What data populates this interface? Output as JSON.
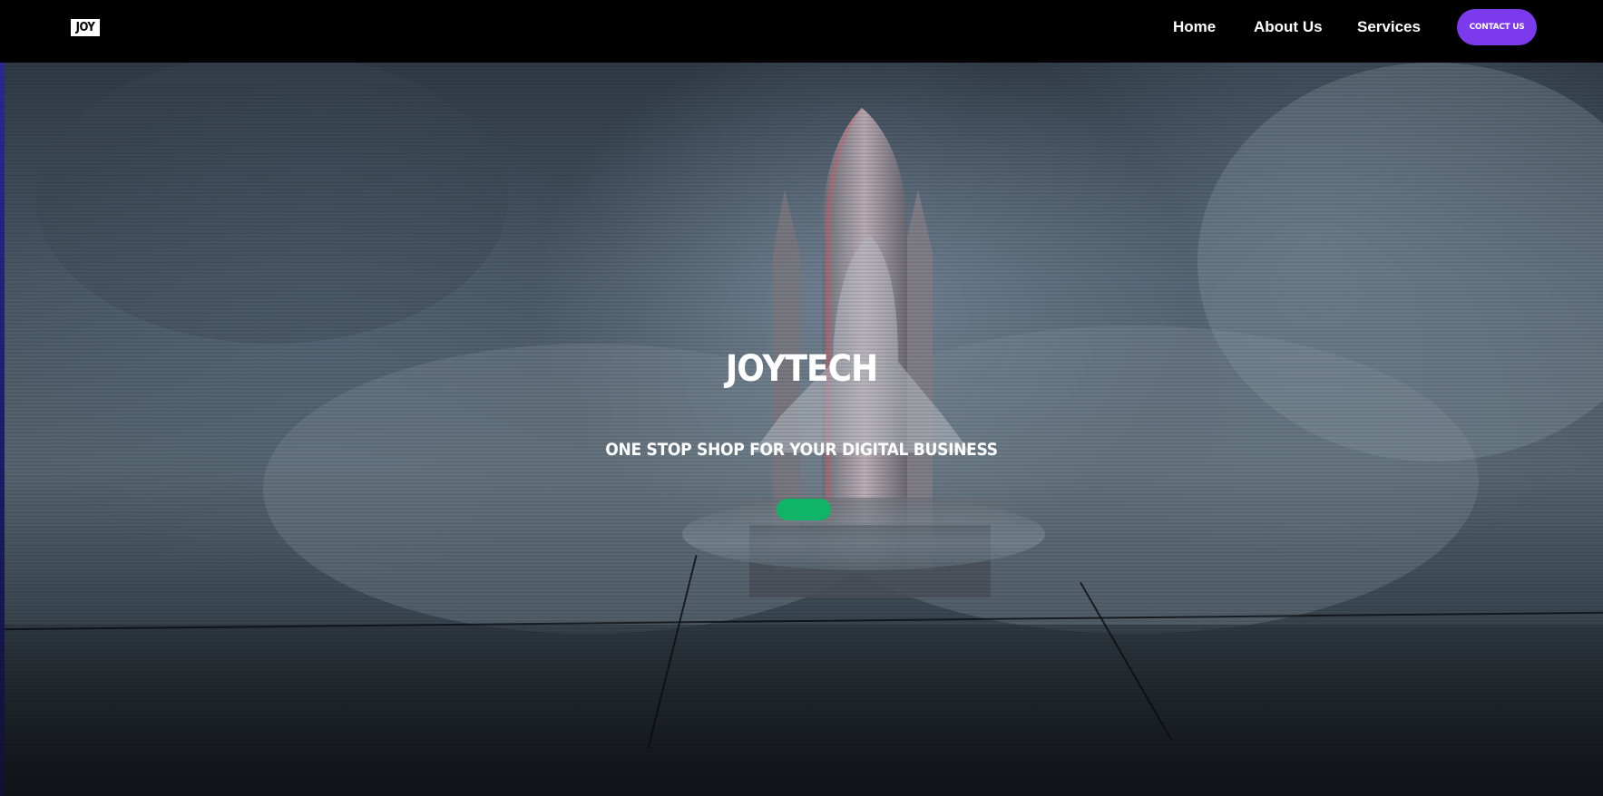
{
  "navbar": {
    "logo_text": "JOY",
    "links": [
      "Home",
      "About Us",
      "Services"
    ],
    "contact_label": "CONTACT US"
  },
  "hero": {
    "title": "JOYTECH",
    "subtitle": "ONE STOP SHOP FOR YOUR DIGITAL BUSINESS",
    "cta_label": ""
  },
  "colors": {
    "navbar_bg": "#000000",
    "contact_button": "#7c3aed",
    "cta_button": "#10b466",
    "text": "#ffffff"
  },
  "icons": {
    "logo": "joy-logo",
    "background_image": "space-shuttle-launch-smoke"
  }
}
